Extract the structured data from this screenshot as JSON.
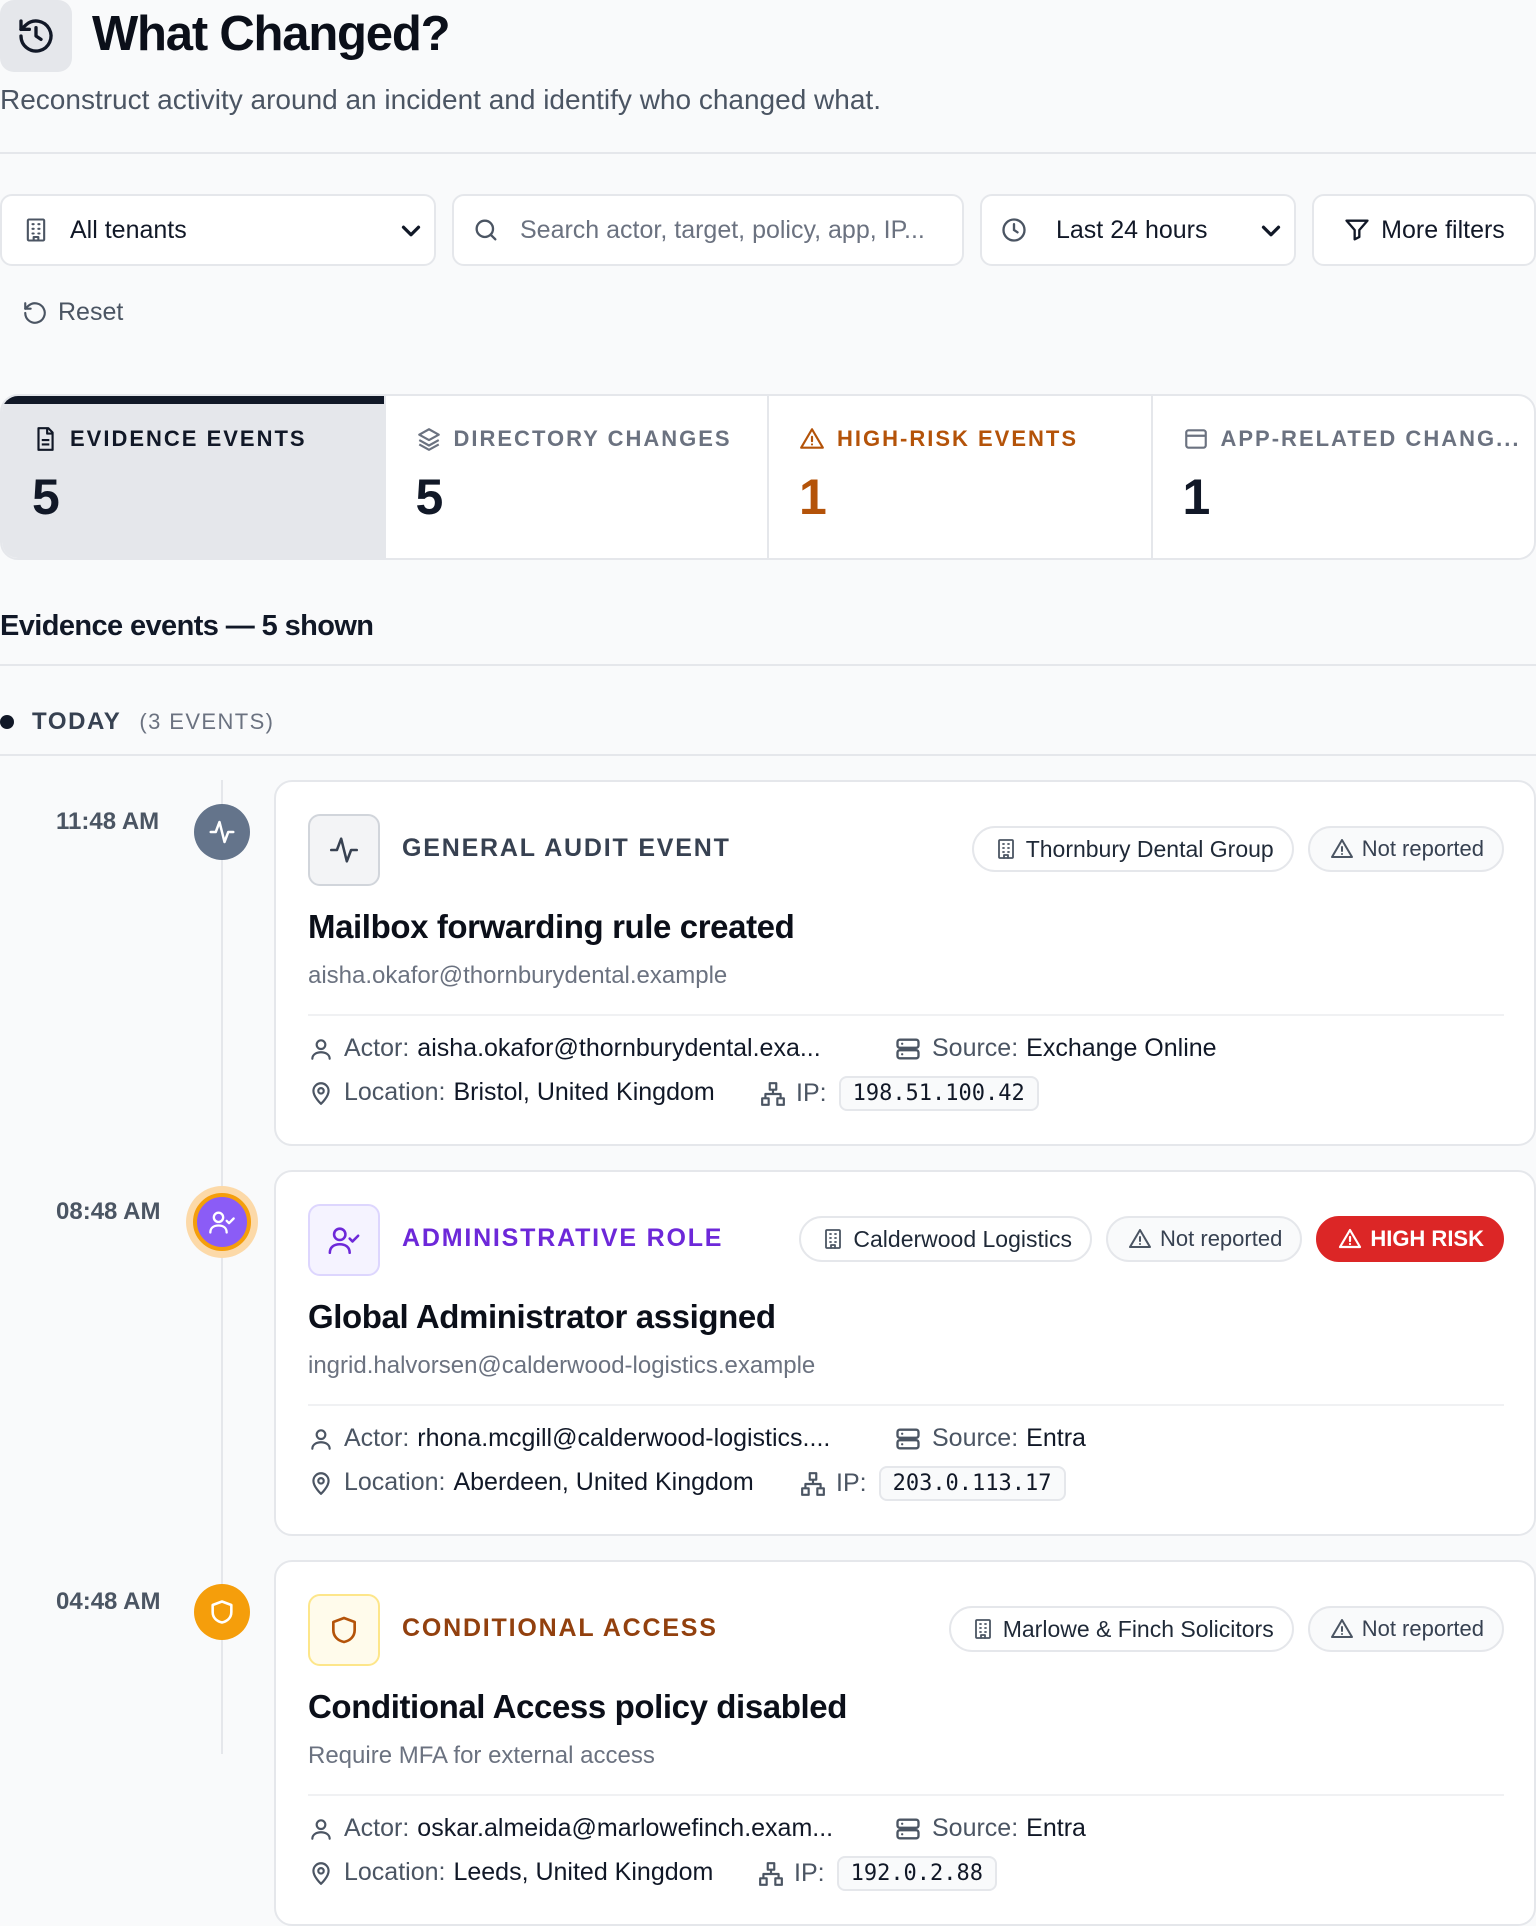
{
  "header": {
    "title": "What Changed?",
    "subtitle": "Reconstruct activity around an incident and identify who changed what."
  },
  "filters": {
    "tenant": "All tenants",
    "search_placeholder": "Search actor, target, policy, app, IP...",
    "time_range": "Last 24 hours",
    "more_filters": "More filters",
    "reset": "Reset"
  },
  "stats": [
    {
      "label": "EVIDENCE EVENTS",
      "value": "5",
      "icon": "document-icon"
    },
    {
      "label": "DIRECTORY CHANGES",
      "value": "5",
      "icon": "layers-icon"
    },
    {
      "label": "HIGH-RISK EVENTS",
      "value": "1",
      "icon": "warning-icon"
    },
    {
      "label": "APP-RELATED CHANG...",
      "value": "1",
      "icon": "app-window-icon"
    }
  ],
  "events_heading": "Evidence events — 5 shown",
  "group": {
    "label": "TODAY",
    "count": "(3 EVENTS)"
  },
  "labels": {
    "actor": "Actor:",
    "source": "Source:",
    "location": "Location:",
    "ip": "IP:"
  },
  "events": [
    {
      "time": "11:48 AM",
      "type": "GENERAL AUDIT EVENT",
      "icon": "activity-icon",
      "tenant": "Thornbury Dental Group",
      "report_status": "Not reported",
      "title": "Mailbox forwarding rule created",
      "subtitle": "aisha.okafor@thornburydental.example",
      "actor": "aisha.okafor@thornburydental.exa...",
      "source": "Exchange Online",
      "location": "Bristol, United Kingdom",
      "ip": "198.51.100.42"
    },
    {
      "time": "08:48 AM",
      "type": "ADMINISTRATIVE ROLE",
      "icon": "user-check-icon",
      "tenant": "Calderwood Logistics",
      "report_status": "Not reported",
      "risk": "HIGH RISK",
      "title": "Global Administrator assigned",
      "subtitle": "ingrid.halvorsen@calderwood-logistics.example",
      "actor": "rhona.mcgill@calderwood-logistics....",
      "source": "Entra",
      "location": "Aberdeen, United Kingdom",
      "ip": "203.0.113.17"
    },
    {
      "time": "04:48 AM",
      "type": "CONDITIONAL ACCESS",
      "icon": "shield-icon",
      "tenant": "Marlowe & Finch Solicitors",
      "report_status": "Not reported",
      "title": "Conditional Access policy disabled",
      "subtitle": "Require MFA for external access",
      "actor": "oskar.almeida@marlowefinch.exam...",
      "source": "Entra",
      "location": "Leeds, United Kingdom",
      "ip": "192.0.2.88"
    }
  ],
  "colors": {
    "accent_warning": "#b45309",
    "admin_purple": "#6d28d9",
    "high_risk": "#dc2626",
    "timeline_slate": "#64748b",
    "timeline_amber": "#f59e0b"
  }
}
